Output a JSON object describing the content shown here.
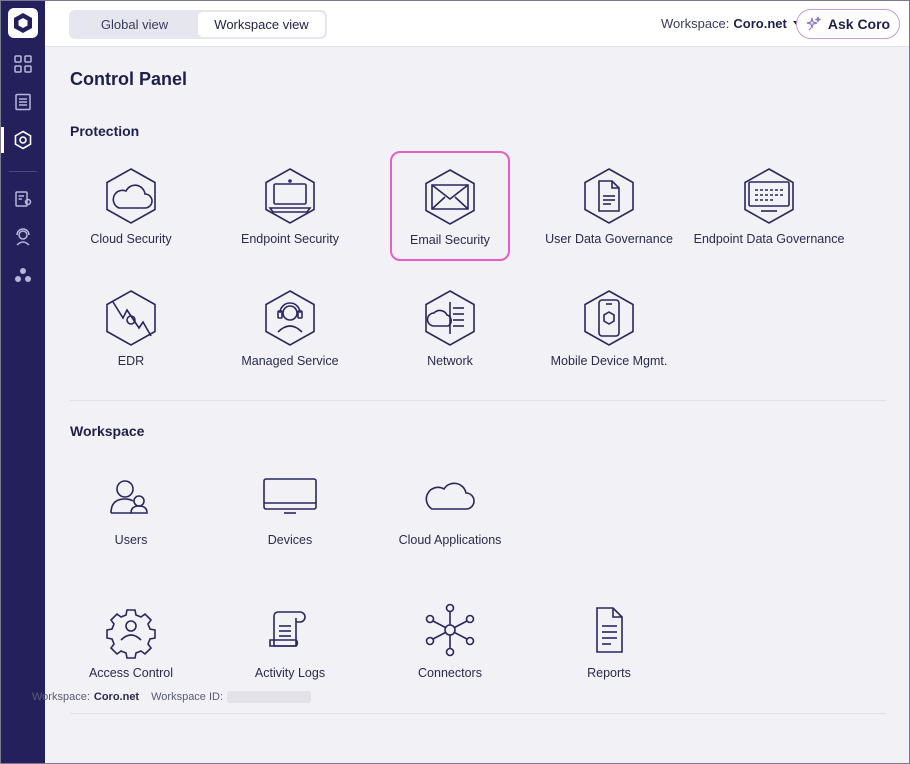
{
  "header": {
    "toggle": [
      "Global view",
      "Workspace view"
    ],
    "active_toggle": "Workspace view",
    "workspace_label": "Workspace:",
    "workspace_value": "Coro.net",
    "ask_button": "Ask Coro"
  },
  "sidebar": {
    "items": [
      {
        "icon": "grid-icon"
      },
      {
        "icon": "list-icon"
      },
      {
        "icon": "hexagon-gear-icon",
        "active": true
      },
      {
        "icon": "reports-settings-icon"
      },
      {
        "icon": "support-agent-icon"
      },
      {
        "icon": "network-nodes-icon"
      }
    ]
  },
  "main": {
    "title": "Control Panel",
    "protection": {
      "title": "Protection",
      "tiles": [
        {
          "label": "Cloud Security",
          "icon": "cloud-hex-icon"
        },
        {
          "label": "Endpoint Security",
          "icon": "laptop-hex-icon"
        },
        {
          "label": "Email Security",
          "icon": "envelope-hex-icon",
          "highlighted": true
        },
        {
          "label": "User Data Governance",
          "icon": "document-hex-icon"
        },
        {
          "label": "Endpoint Data Governance",
          "icon": "screen-data-hex-icon"
        },
        {
          "label": "EDR",
          "icon": "edr-hex-icon"
        },
        {
          "label": "Managed Service",
          "icon": "headset-hex-icon"
        },
        {
          "label": "Network",
          "icon": "network-hex-icon"
        },
        {
          "label": "Mobile Device Mgmt.",
          "icon": "mobile-hex-icon"
        }
      ]
    },
    "workspace": {
      "title": "Workspace",
      "tiles": [
        {
          "label": "Users",
          "icon": "users-icon"
        },
        {
          "label": "Devices",
          "icon": "monitor-icon"
        },
        {
          "label": "Cloud Applications",
          "icon": "cloud-icon"
        },
        {
          "label": "Access Control",
          "icon": "gear-user-icon"
        },
        {
          "label": "Activity Logs",
          "icon": "scroll-icon"
        },
        {
          "label": "Connectors",
          "icon": "hub-icon"
        },
        {
          "label": "Reports",
          "icon": "report-icon"
        }
      ]
    }
  },
  "footer": {
    "workspace_label": "Workspace:",
    "workspace_value": "Coro.net",
    "workspace_id_label": "Workspace ID:"
  },
  "colors": {
    "sidebar": "#24205c",
    "text": "#1f1f4d",
    "highlight": "#e65fc6",
    "ask_border": "#c89ad6"
  }
}
